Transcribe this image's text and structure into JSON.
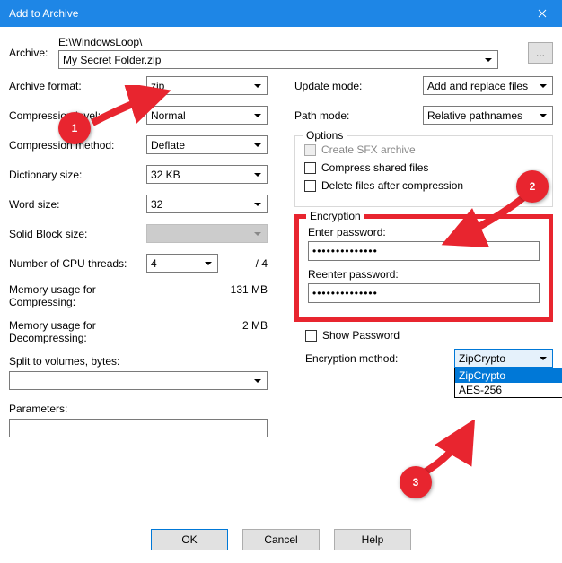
{
  "window": {
    "title": "Add to Archive"
  },
  "archive": {
    "label": "Archive:",
    "path": "E:\\WindowsLoop\\",
    "filename": "My Secret Folder.zip",
    "browse": "..."
  },
  "left": {
    "format": {
      "label": "Archive format:",
      "value": "zip"
    },
    "level": {
      "label": "Compression level:",
      "value": "Normal"
    },
    "method": {
      "label": "Compression method:",
      "value": "Deflate"
    },
    "dict": {
      "label": "Dictionary size:",
      "value": "32 KB"
    },
    "word": {
      "label": "Word size:",
      "value": "32"
    },
    "solid": {
      "label": "Solid Block size:",
      "value": ""
    },
    "cpu": {
      "label": "Number of CPU threads:",
      "value": "4",
      "total": "/ 4"
    },
    "mem_comp": {
      "label": "Memory usage for Compressing:",
      "value": "131 MB"
    },
    "mem_decomp": {
      "label": "Memory usage for Decompressing:",
      "value": "2 MB"
    },
    "split": {
      "label": "Split to volumes, bytes:",
      "value": ""
    },
    "params": {
      "label": "Parameters:",
      "value": ""
    }
  },
  "right": {
    "update": {
      "label": "Update mode:",
      "value": "Add and replace files"
    },
    "pathmode": {
      "label": "Path mode:",
      "value": "Relative pathnames"
    },
    "options": {
      "legend": "Options",
      "sfx": "Create SFX archive",
      "shared": "Compress shared files",
      "delete": "Delete files after compression"
    },
    "encryption": {
      "legend": "Encryption",
      "enter_label": "Enter password:",
      "enter_value": "••••••••••••••",
      "reenter_label": "Reenter password:",
      "reenter_value": "••••••••••••••",
      "show": "Show Password",
      "method_label": "Encryption method:",
      "method_value": "ZipCrypto",
      "options": {
        "a": "ZipCrypto",
        "b": "AES-256"
      }
    }
  },
  "buttons": {
    "ok": "OK",
    "cancel": "Cancel",
    "help": "Help"
  },
  "callouts": {
    "c1": "1",
    "c2": "2",
    "c3": "3"
  }
}
